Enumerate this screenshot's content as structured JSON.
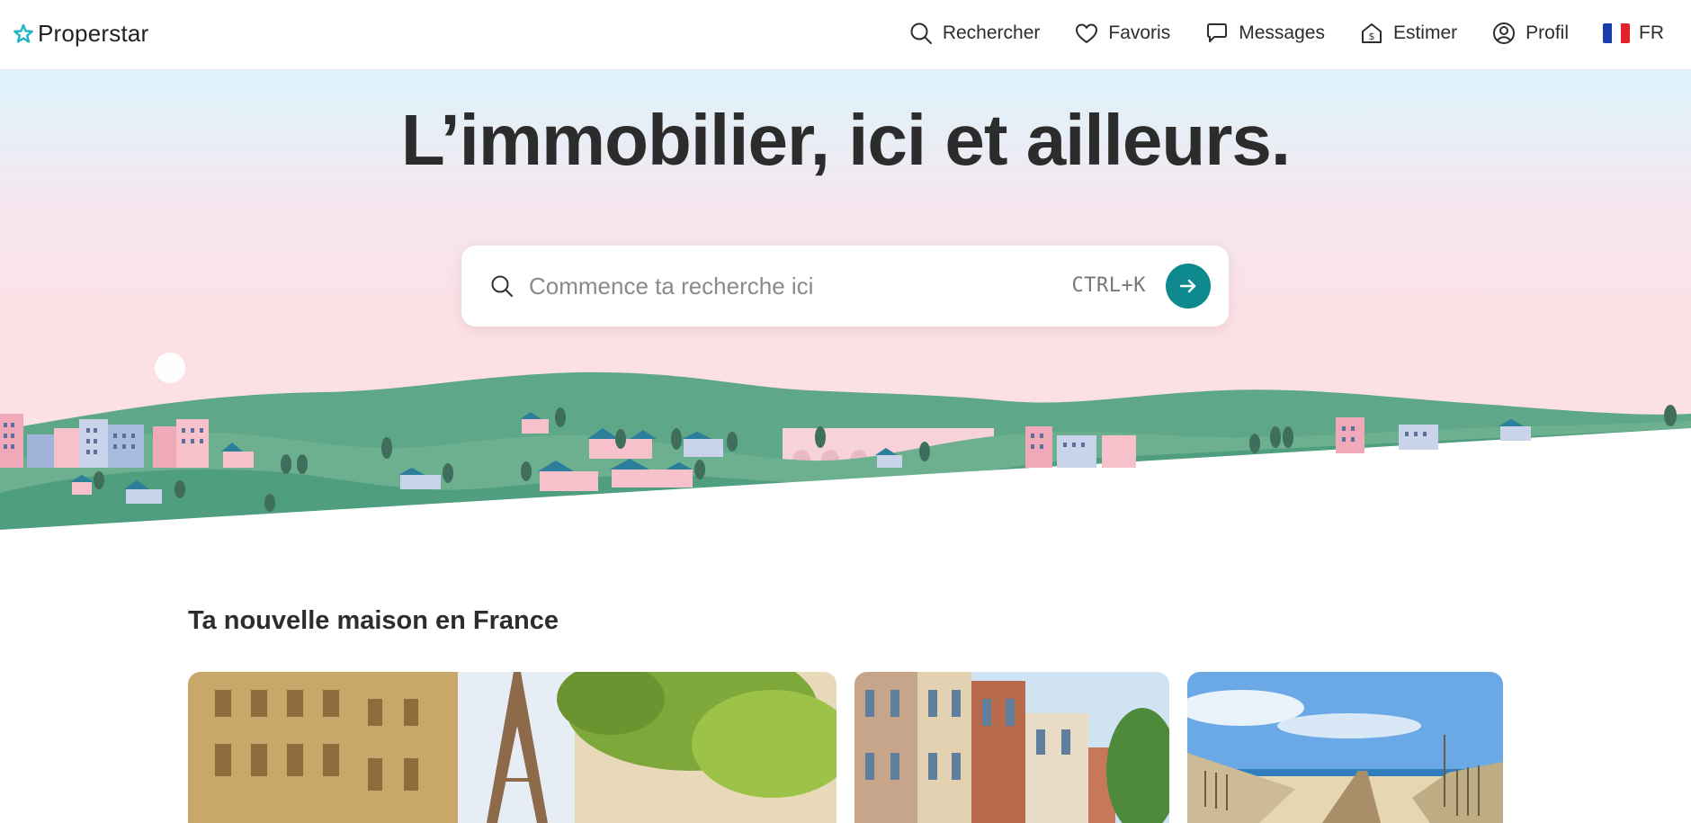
{
  "header": {
    "logo_text": "Properstar",
    "nav": [
      {
        "label": "Rechercher",
        "icon": "search-icon"
      },
      {
        "label": "Favoris",
        "icon": "heart-icon"
      },
      {
        "label": "Messages",
        "icon": "chat-bubble-icon"
      },
      {
        "label": "Estimer",
        "icon": "house-dollar-icon"
      },
      {
        "label": "Profil",
        "icon": "user-circle-icon"
      },
      {
        "label": "FR",
        "icon": "france-flag-icon"
      }
    ]
  },
  "hero": {
    "title": "L’immobilier, ici et ailleurs.",
    "search": {
      "placeholder": "Commence ta recherche ici",
      "value": "",
      "shortcut": "CTRL+K"
    }
  },
  "section": {
    "title": "Ta nouvelle maison en France"
  },
  "colors": {
    "accent": "#0e8a8f",
    "logo": "#1cb5c4",
    "hills_dark": "#4f9e80",
    "hills_light": "#77b996"
  }
}
